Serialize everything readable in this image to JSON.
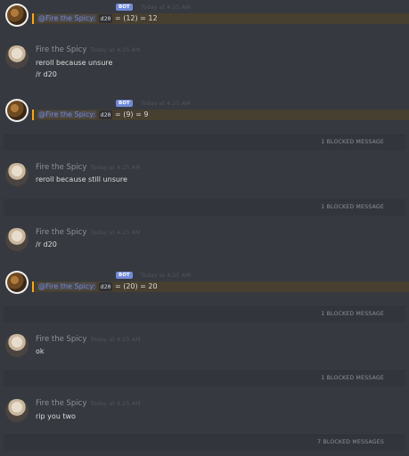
{
  "messages": [
    {
      "ts": "Today at 4:25 AM",
      "bot_badge": "BOT",
      "mention": "@Fire the Spicy:",
      "code": "d20",
      "result": "= (12) = 12"
    },
    {
      "user": "Fire the Spicy",
      "ts": "Today at 4:25 AM",
      "lines": [
        "reroll because unsure",
        "/r d20"
      ]
    },
    {
      "ts": "Today at 4:25 AM",
      "bot_badge": "BOT",
      "mention": "@Fire the Spicy:",
      "code": "d20",
      "result": "= (9) = 9"
    },
    {
      "user": "Fire the Spicy",
      "ts": "Today at 4:25 AM",
      "lines": [
        "reroll because still unsure"
      ]
    },
    {
      "user": "Fire the Spicy",
      "ts": "Today at 4:25 AM",
      "lines": [
        "/r d20"
      ]
    },
    {
      "ts": "Today at 4:25 AM",
      "bot_badge": "BOT",
      "mention": "@Fire the Spicy:",
      "code": "d20",
      "result": "= (20) = 20"
    },
    {
      "user": "Fire the Spicy",
      "ts": "Today at 4:25 AM",
      "lines": [
        "ok"
      ]
    },
    {
      "user": "Fire the Spicy",
      "ts": "Today at 4:25 AM",
      "lines": [
        "rip you two"
      ]
    }
  ],
  "blocked": [
    "1 BLOCKED MESSAGE",
    "1 BLOCKED MESSAGE",
    "1 BLOCKED MESSAGE",
    "1 BLOCKED MESSAGE",
    "7 BLOCKED MESSAGES"
  ],
  "colors": {
    "background": "#36393f",
    "mention": "#7289da",
    "bot_badge": "#7289da",
    "highlight_bar": "#faa61a"
  }
}
